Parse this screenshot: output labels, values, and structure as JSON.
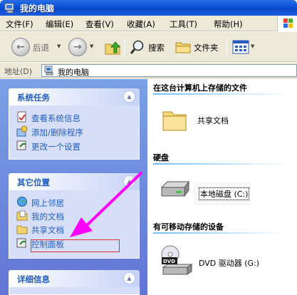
{
  "window": {
    "title": "我的电脑"
  },
  "menu": [
    {
      "label": "文件(F)"
    },
    {
      "label": "编辑(E)"
    },
    {
      "label": "查看(V)"
    },
    {
      "label": "收藏(A)"
    },
    {
      "label": "工具(T)"
    },
    {
      "label": "帮助(H)"
    }
  ],
  "toolbar": {
    "back": "后退",
    "search": "搜索",
    "folders": "文件夹"
  },
  "address": {
    "label": "地址(D)",
    "value": "我的电脑"
  },
  "left": {
    "system_tasks": {
      "title": "系统任务",
      "items": [
        {
          "label": "查看系统信息"
        },
        {
          "label": "添加/删除程序"
        },
        {
          "label": "更改一个设置"
        }
      ]
    },
    "other_places": {
      "title": "其它位置",
      "items": [
        {
          "label": "网上邻居"
        },
        {
          "label": "我的文档"
        },
        {
          "label": "共享文档"
        },
        {
          "label": "控制面板"
        }
      ]
    },
    "details": {
      "title": "详细信息"
    }
  },
  "right": {
    "stored_files": {
      "title": "在这台计算机上存储的文件",
      "item": "共享文档"
    },
    "hard_disks": {
      "title": "硬盘",
      "item": "本地磁盘 (C:)"
    },
    "removable": {
      "title": "有可移动存储的设备",
      "item": "DVD 驱动器 (G:)"
    }
  },
  "colors": {
    "annotation_arrow": "#ff00ff",
    "annotation_box": "#e03030"
  }
}
